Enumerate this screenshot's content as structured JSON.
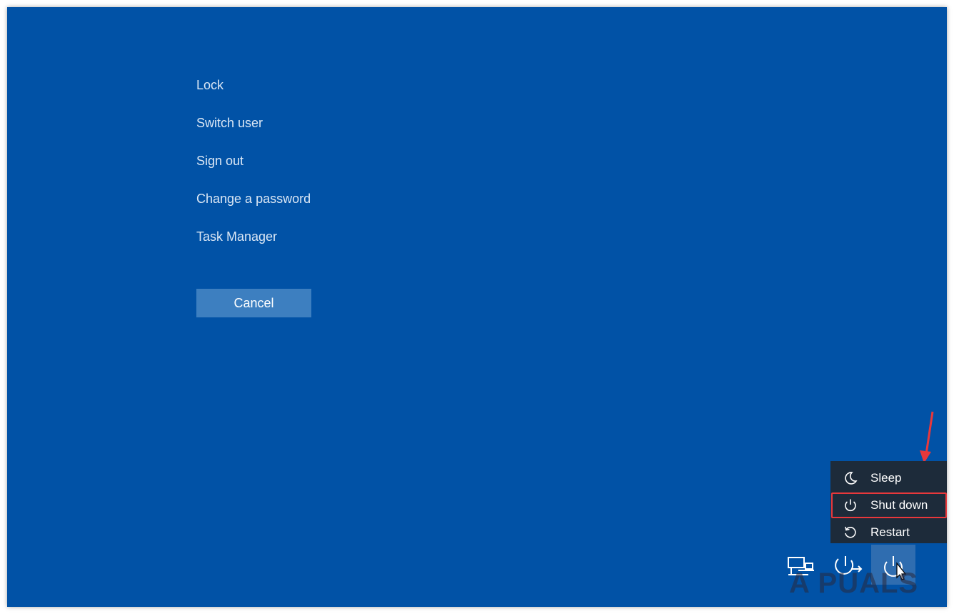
{
  "security_options": [
    {
      "label": "Lock"
    },
    {
      "label": "Switch user"
    },
    {
      "label": "Sign out"
    },
    {
      "label": "Change a password"
    },
    {
      "label": "Task Manager"
    }
  ],
  "cancel_label": "Cancel",
  "power_menu": {
    "items": [
      {
        "label": "Sleep",
        "icon": "moon-icon"
      },
      {
        "label": "Shut down",
        "icon": "power-icon",
        "highlighted": true
      },
      {
        "label": "Restart",
        "icon": "restart-icon"
      }
    ]
  },
  "tray": {
    "icons": [
      "network-icon",
      "accessibility-icon",
      "power-icon"
    ]
  },
  "watermark": "A   PUALS",
  "colors": {
    "background": "#0152a6",
    "menu_background": "#1d2b3a",
    "highlight": "#e8383b",
    "cancel_button": "#3d7fc0"
  }
}
